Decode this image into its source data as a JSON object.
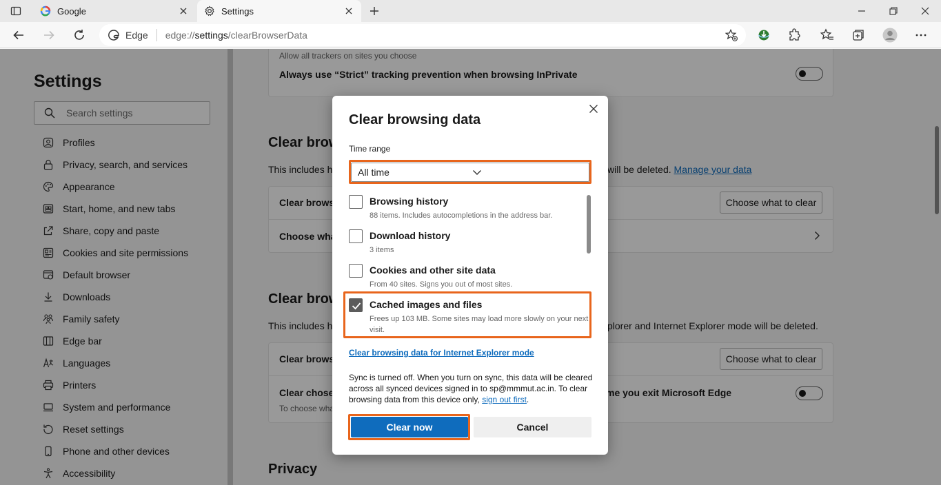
{
  "tabs": [
    {
      "title": "Google",
      "icon": "google-icon"
    },
    {
      "title": "Settings",
      "icon": "gear-icon"
    }
  ],
  "address": {
    "site_label": "Edge",
    "url_prefix": "edge://",
    "url_host": "settings",
    "url_path": "/clearBrowserData"
  },
  "sidebar": {
    "title": "Settings",
    "search_placeholder": "Search settings",
    "items": [
      {
        "label": "Profiles",
        "icon": "profile-icon"
      },
      {
        "label": "Privacy, search, and services",
        "icon": "lock-icon"
      },
      {
        "label": "Appearance",
        "icon": "appearance-icon"
      },
      {
        "label": "Start, home, and new tabs",
        "icon": "home-tabs-icon"
      },
      {
        "label": "Share, copy and paste",
        "icon": "share-icon"
      },
      {
        "label": "Cookies and site permissions",
        "icon": "cookies-icon"
      },
      {
        "label": "Default browser",
        "icon": "browser-icon"
      },
      {
        "label": "Downloads",
        "icon": "download-icon"
      },
      {
        "label": "Family safety",
        "icon": "family-icon"
      },
      {
        "label": "Edge bar",
        "icon": "edge-bar-icon"
      },
      {
        "label": "Languages",
        "icon": "language-icon"
      },
      {
        "label": "Printers",
        "icon": "printer-icon"
      },
      {
        "label": "System and performance",
        "icon": "system-icon"
      },
      {
        "label": "Reset settings",
        "icon": "reset-icon"
      },
      {
        "label": "Phone and other devices",
        "icon": "phone-icon"
      },
      {
        "label": "Accessibility",
        "icon": "accessibility-icon"
      }
    ]
  },
  "content": {
    "trackers_text": "Allow all trackers on sites you choose",
    "strict_label": "Always use “Strict” tracking prevention when browsing InPrivate",
    "section1_title": "Clear brow",
    "section1_desc_start": "This includes hi",
    "section1_desc_end": "will be deleted.",
    "manage_link": "Manage your data",
    "row1_label": "Clear browsi",
    "choose_btn": "Choose what to clear",
    "row2_label": "Choose wha",
    "section2_title": "Clear brow",
    "section2_desc_start": "This includes hi",
    "section2_desc_end": "plorer and Internet Explorer mode will be deleted.",
    "row3_label": "Clear browsi",
    "row4_label": "Clear choser",
    "row4_sub": "To choose wha",
    "row4_end": "me you exit Microsoft Edge",
    "privacy_title": "Privacy"
  },
  "dialog": {
    "title": "Clear browsing data",
    "time_range_label": "Time range",
    "time_range_value": "All time",
    "items": [
      {
        "title": "Browsing history",
        "sub": "88 items. Includes autocompletions in the address bar.",
        "checked": false
      },
      {
        "title": "Download history",
        "sub": "3 items",
        "checked": false
      },
      {
        "title": "Cookies and other site data",
        "sub": "From 40 sites. Signs you out of most sites.",
        "checked": false
      },
      {
        "title": "Cached images and files",
        "sub": "Frees up 103 MB. Some sites may load more slowly on your next visit.",
        "checked": true
      }
    ],
    "ie_link": "Clear browsing data for Internet Explorer mode",
    "sync_text": "Sync is turned off. When you turn on sync, this data will be cleared across all synced devices signed in to sp@mmmut.ac.in. To clear browsing data from this device only,",
    "sign_out_link": "sign out first",
    "sync_end": ".",
    "clear_now": "Clear now",
    "cancel": "Cancel"
  },
  "colors": {
    "accent": "#0f6cbd",
    "highlight": "#e8651c"
  }
}
